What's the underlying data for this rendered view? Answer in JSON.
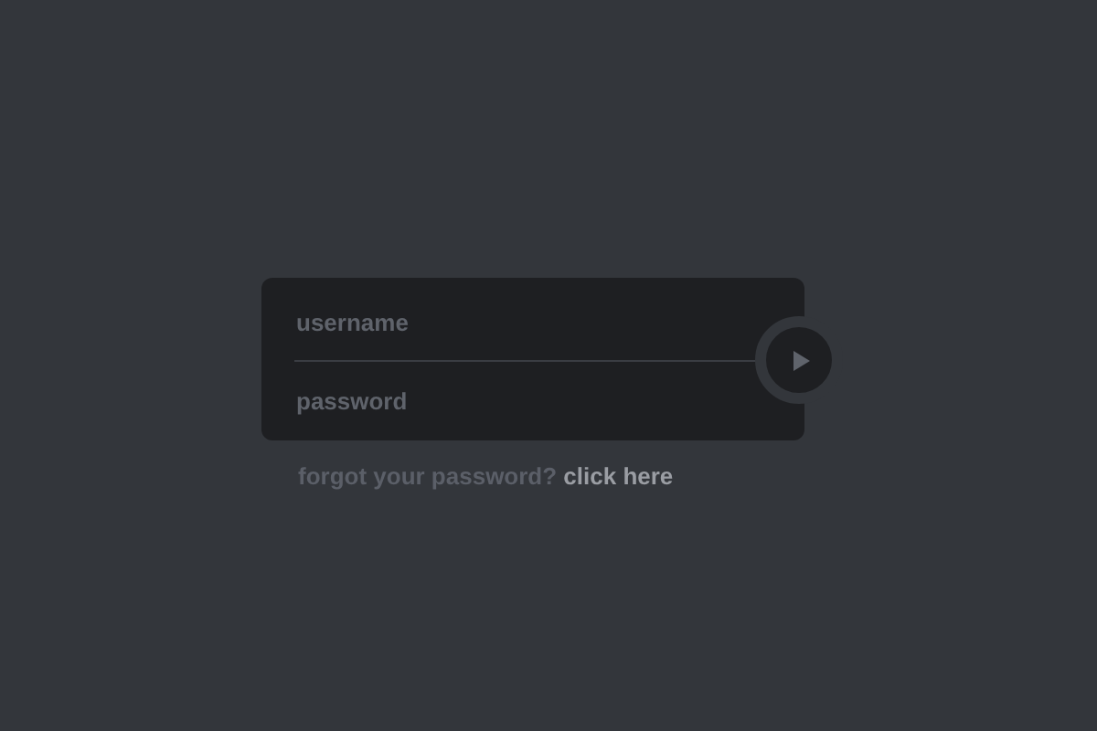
{
  "login": {
    "username": {
      "placeholder": "username"
    },
    "password": {
      "placeholder": "password"
    },
    "forgot": {
      "text": "forgot your password?",
      "link": "click here"
    }
  }
}
